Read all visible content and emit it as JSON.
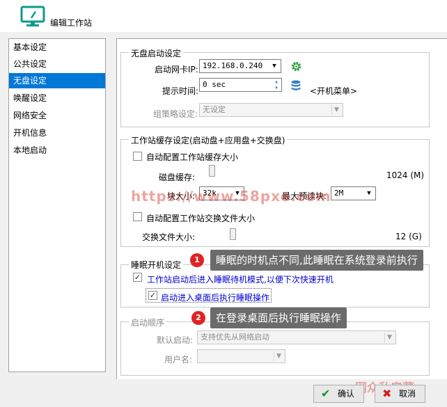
{
  "window": {
    "title": "编辑工作站",
    "accent": "#0a9b8c"
  },
  "sidebar": {
    "items": [
      {
        "label": "基本设定"
      },
      {
        "label": "公共设定"
      },
      {
        "label": "无盘设定"
      },
      {
        "label": "唤醒设定"
      },
      {
        "label": "网络安全"
      },
      {
        "label": "开机信息"
      },
      {
        "label": "本地启动"
      }
    ],
    "selected_index": 2
  },
  "diskless_boot": {
    "group_title": "无盘启动设定",
    "nic_label": "启动网卡IP:",
    "nic_value": "192.168.0.240",
    "nic_settings_icon": "gear-icon",
    "prompt_label": "提示时间:",
    "prompt_value": "0 sec",
    "boot_menu_icon": "database-icon",
    "boot_menu_label": "<开机菜单>",
    "policy_label": "组策略设定:",
    "policy_value": "无设定"
  },
  "cache": {
    "group_title": "工作站缓存设定(启动盘+应用盘+交换盘)",
    "auto_cache_label": "自动配置工作站缓存大小",
    "auto_cache_checked": false,
    "disk_cache_label": "磁盘缓存:",
    "disk_cache_value": "1024 (M)",
    "block_size_label": "块大小:",
    "block_size_value": "32k",
    "max_preread_label": "最大预读块:",
    "max_preread_value": "2M",
    "auto_swap_label": "自动配置工作站交换文件大小",
    "auto_swap_checked": false,
    "swap_size_label": "交换文件大小:",
    "swap_size_value": "12 (G)"
  },
  "sleep": {
    "group_title": "睡眠开机设定",
    "standby_label": "工作站启动后进入睡眠待机模式,以便下次快速开机",
    "standby_checked": true,
    "desktop_sleep_label": "启动进入桌面后执行睡眠操作",
    "desktop_sleep_checked": true
  },
  "boot_order": {
    "group_title": "启动顺序",
    "default_label": "默认启动:",
    "default_value": "支持优先从网络启动",
    "username_label": "用户名:",
    "username_value": ""
  },
  "annotations": {
    "callout1_num": "1",
    "callout1_text": "睡眠的时机点不同,此睡眠在系统登录前执行",
    "callout2_num": "2",
    "callout2_text": "在登录桌面后执行睡眠操作",
    "badge_color": "#e02424"
  },
  "buttons": {
    "ok_label": "确认",
    "cancel_label": "取消"
  },
  "watermarks": {
    "url_text": "https://www.58pxe.com",
    "brand_text": "网众私房菜"
  }
}
